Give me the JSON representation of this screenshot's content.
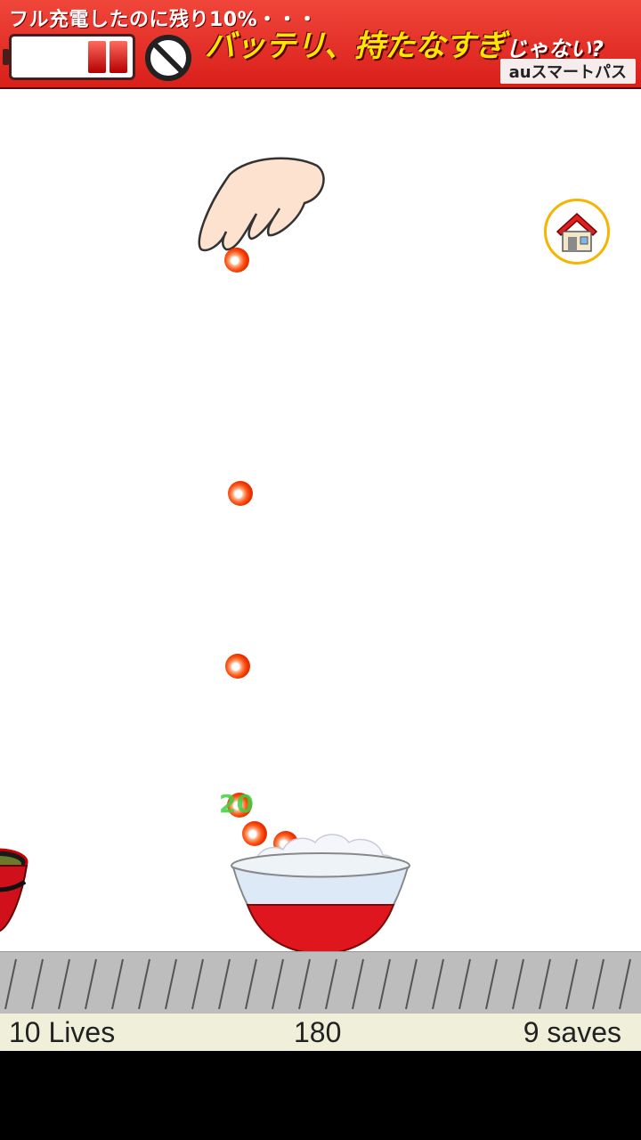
{
  "ad": {
    "top_text": "フル充電したのに残り10%・・・",
    "main_text": "バッテリ、持たなすぎ",
    "main_suffix": "じゃない?",
    "brand": "auスマートパス"
  },
  "game": {
    "floating_score": "20",
    "status": {
      "lives": "10 Lives",
      "score": "180",
      "saves": "9 saves"
    }
  },
  "icons": {
    "home": "home-icon",
    "hand": "hand-pointing-icon",
    "rice_bowl": "rice-bowl-icon",
    "soup_bowl": "soup-bowl-icon",
    "ikura": "salmon-roe-icon"
  }
}
